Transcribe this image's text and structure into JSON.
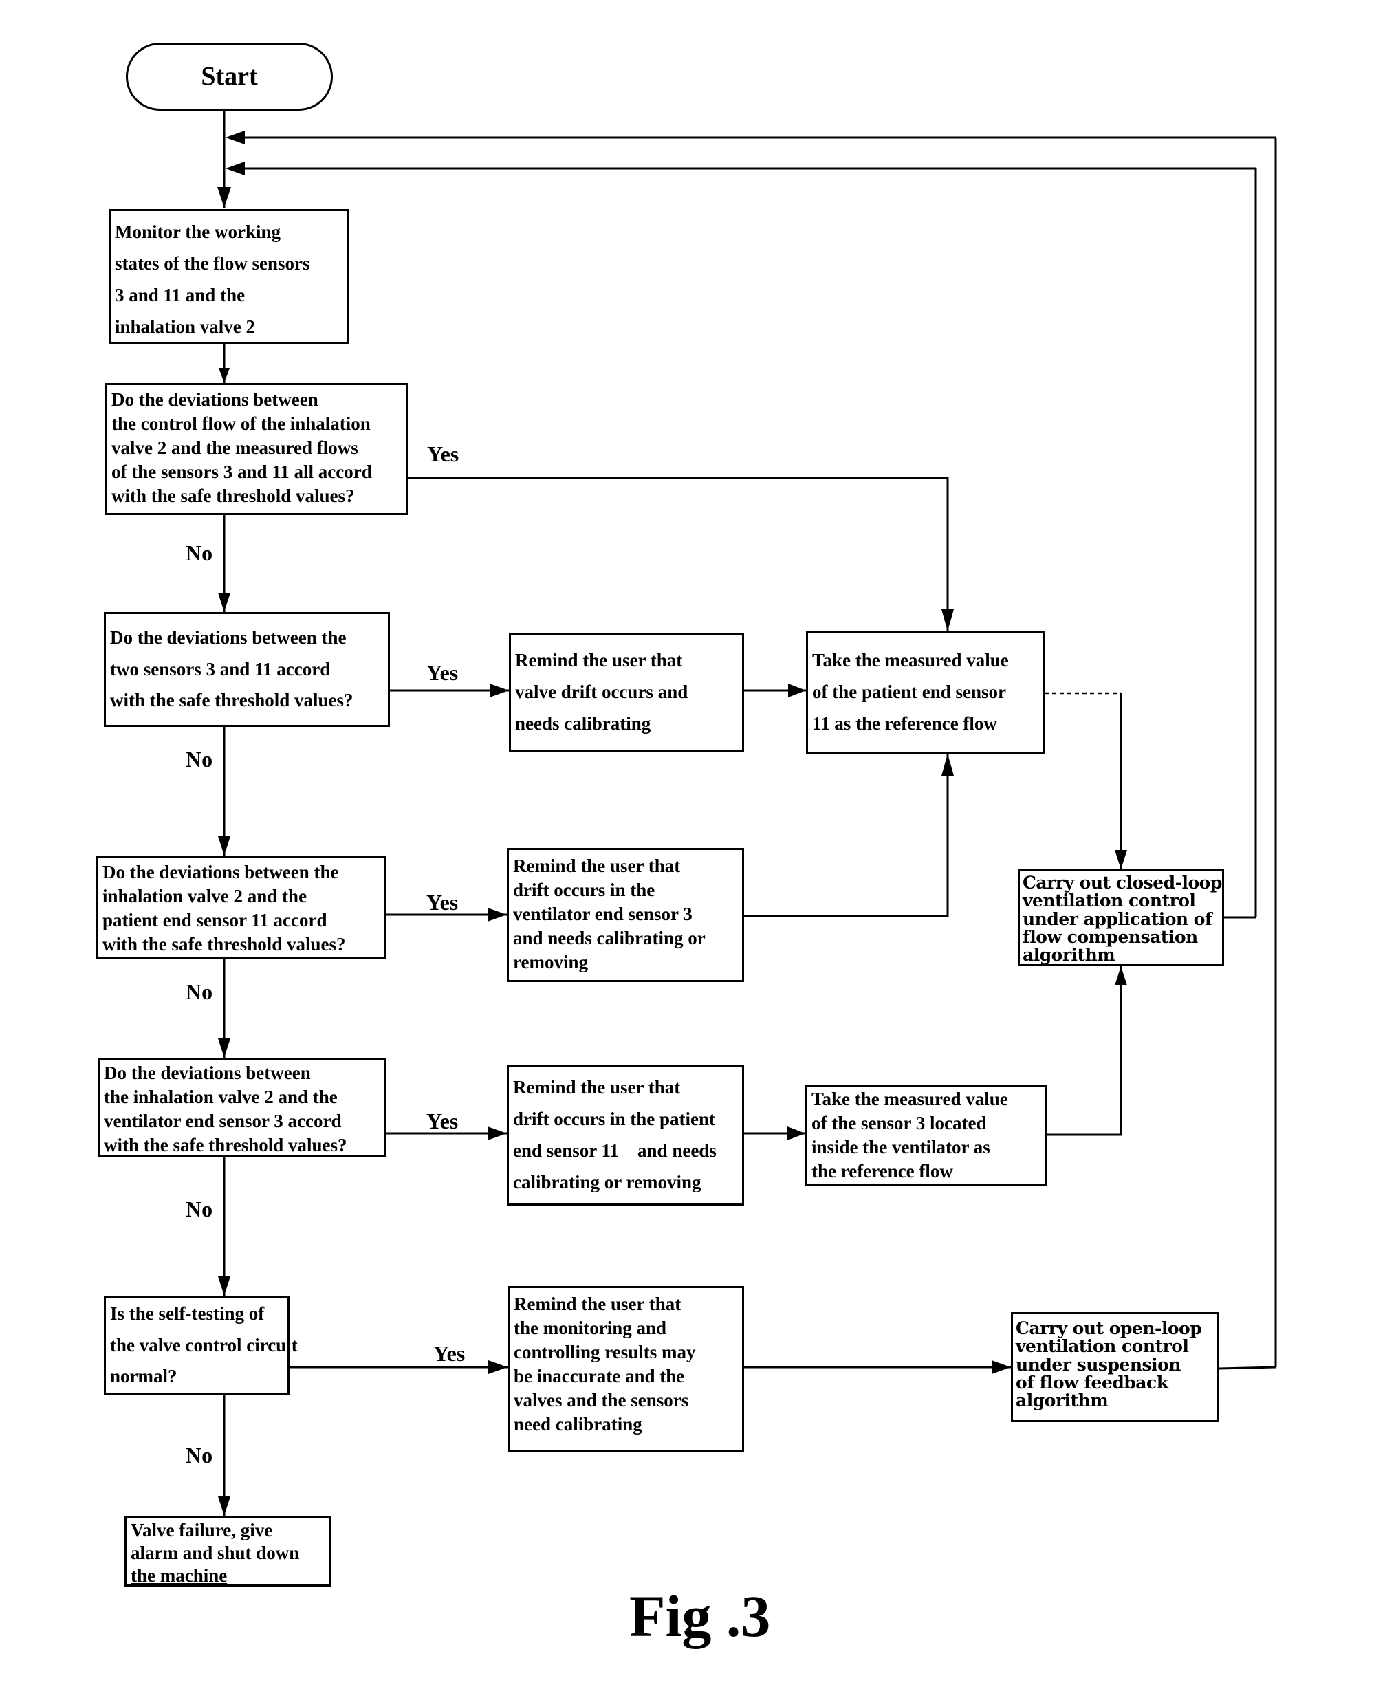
{
  "figure_caption": "Fig .3",
  "nodes": {
    "start": {
      "text": "Start"
    },
    "monitor": {
      "lines": [
        "Monitor the working",
        "states of the flow sensors",
        "3 and 11 and the",
        "inhalation valve 2"
      ]
    },
    "decision1": {
      "lines": [
        "Do the deviations between",
        "the control flow of the inhalation",
        "valve 2 and the measured flows",
        "of the sensors 3 and 11 all accord",
        "with the safe threshold values?"
      ]
    },
    "decision2": {
      "lines": [
        "Do the deviations between the",
        "two sensors 3 and 11 accord",
        "with the safe threshold values?"
      ]
    },
    "remind_valve_drift": {
      "lines": [
        "Remind the user that",
        "valve drift occurs and",
        "needs calibrating"
      ]
    },
    "take_patient_sensor": {
      "lines": [
        "Take the measured value",
        "of the patient end sensor",
        "11 as the reference flow"
      ]
    },
    "decision3": {
      "lines": [
        "Do the deviations between the",
        "inhalation valve 2 and the",
        "patient end sensor 11 accord",
        "with the safe threshold values?"
      ]
    },
    "remind_ventilator_sensor": {
      "lines": [
        "Remind the user that",
        "drift occurs in the",
        "ventilator end sensor 3",
        "and needs calibrating or",
        "removing"
      ]
    },
    "closed_loop": {
      "lines": [
        "Carry out closed-loop",
        "ventilation control",
        "under application of",
        "flow compensation",
        "algorithm"
      ]
    },
    "decision4": {
      "lines": [
        "Do the deviations between",
        "the inhalation valve 2 and the",
        "ventilator end sensor 3 accord",
        "with the safe threshold values?"
      ]
    },
    "remind_patient_sensor": {
      "lines": [
        "Remind the user that",
        "drift occurs in the patient",
        "end sensor 11    and needs",
        "calibrating or removing"
      ]
    },
    "take_sensor3": {
      "lines": [
        "Take the measured value",
        "of the sensor 3 located",
        "inside the ventilator as",
        "the reference flow"
      ]
    },
    "decision5": {
      "lines": [
        "Is the self-testing of",
        "the valve control circuit",
        "normal?"
      ]
    },
    "remind_inaccurate": {
      "lines": [
        "Remind the user that",
        "the monitoring and",
        "controlling results may",
        "be inaccurate and the",
        "valves and the sensors",
        "need calibrating"
      ]
    },
    "open_loop": {
      "lines": [
        "Carry out open-loop",
        "ventilation control",
        "under suspension",
        "of flow feedback",
        "algorithm"
      ]
    },
    "valve_failure": {
      "lines": [
        "Valve failure, give",
        "alarm and shut down",
        "the machine"
      ]
    }
  },
  "edge_labels": {
    "d1_yes": "Yes",
    "d1_no": "No",
    "d2_yes": "Yes",
    "d2_no": "No",
    "d3_yes": "Yes",
    "d3_no": "No",
    "d4_yes": "Yes",
    "d4_no": "No",
    "d5_yes": "Yes",
    "d5_no": "No"
  },
  "edges": [
    {
      "from": "start",
      "to": "monitor"
    },
    {
      "from": "monitor",
      "to": "decision1"
    },
    {
      "from": "decision1",
      "to": "take_patient_sensor",
      "label": "Yes"
    },
    {
      "from": "decision1",
      "to": "decision2",
      "label": "No"
    },
    {
      "from": "decision2",
      "to": "remind_valve_drift",
      "label": "Yes"
    },
    {
      "from": "decision2",
      "to": "decision3",
      "label": "No"
    },
    {
      "from": "remind_valve_drift",
      "to": "take_patient_sensor"
    },
    {
      "from": "take_patient_sensor",
      "to": "closed_loop"
    },
    {
      "from": "decision3",
      "to": "remind_ventilator_sensor",
      "label": "Yes"
    },
    {
      "from": "decision3",
      "to": "decision4",
      "label": "No"
    },
    {
      "from": "remind_ventilator_sensor",
      "to": "take_patient_sensor"
    },
    {
      "from": "decision4",
      "to": "remind_patient_sensor",
      "label": "Yes"
    },
    {
      "from": "decision4",
      "to": "decision5",
      "label": "No"
    },
    {
      "from": "remind_patient_sensor",
      "to": "take_sensor3"
    },
    {
      "from": "take_sensor3",
      "to": "closed_loop"
    },
    {
      "from": "closed_loop",
      "to": "monitor"
    },
    {
      "from": "decision5",
      "to": "remind_inaccurate",
      "label": "Yes"
    },
    {
      "from": "decision5",
      "to": "valve_failure",
      "label": "No"
    },
    {
      "from": "remind_inaccurate",
      "to": "open_loop"
    },
    {
      "from": "open_loop",
      "to": "monitor"
    }
  ]
}
